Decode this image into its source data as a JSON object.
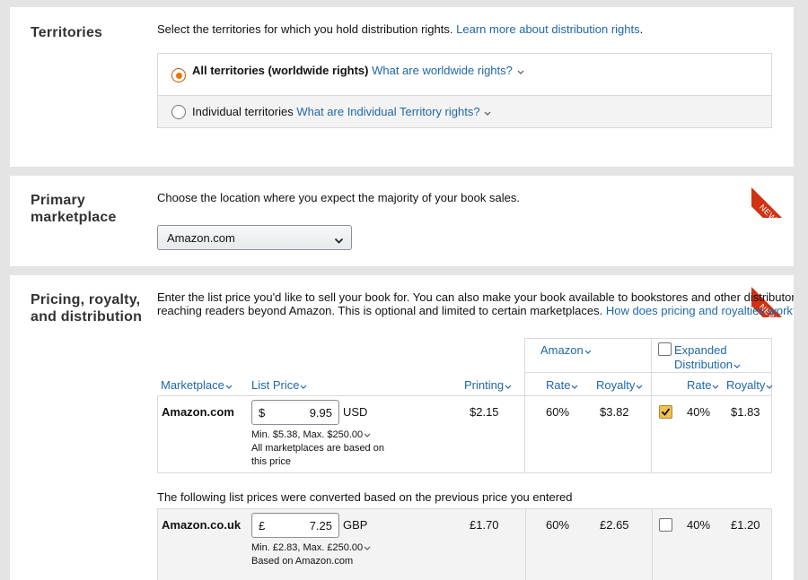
{
  "territories": {
    "title": "Territories",
    "intro": "Select the territories for which you hold distribution rights.",
    "learn_more_link": "Learn more about distribution rights",
    "option_all_label": "All territories (worldwide rights)",
    "option_all_link": "What are worldwide rights?",
    "option_individual_label": "Individual territories",
    "option_individual_link": "What are Individual Territory rights?",
    "selected": "all"
  },
  "marketplace": {
    "title_line1": "Primary",
    "title_line2": "marketplace",
    "intro": "Choose the location where you expect the majority of your book sales.",
    "selected": "Amazon.com",
    "badge": "NEW"
  },
  "pricing": {
    "title_line1": "Pricing, royalty,",
    "title_line2": "and distribution",
    "badge": "NEW",
    "intro_line1": "Enter the list price you'd like to sell your book for. You can also make your book available to bookstores and other distributors,",
    "intro_line2": "reaching readers beyond Amazon. This is optional and limited to certain marketplaces.",
    "intro_link": "How does pricing and royalties work?",
    "headers": {
      "amazon": "Amazon",
      "expanded_line1": "Expanded",
      "expanded_line2": "Distribution",
      "marketplace": "Marketplace",
      "list_price": "List Price",
      "printing": "Printing",
      "rate": "Rate",
      "royalty": "Royalty",
      "exp_rate": "Rate",
      "exp_royalty": "Royalty"
    },
    "expanded_all_checked": false,
    "rows": [
      {
        "marketplace": "Amazon.com",
        "currency_symbol": "$",
        "price": "9.95",
        "currency_code": "USD",
        "range": "Min. $5.38, Max. $250.00",
        "note_line1": "All marketplaces are based on",
        "note_line2": "this price",
        "printing": "$2.15",
        "rate": "60%",
        "royalty": "$3.82",
        "expanded_checked": true,
        "exp_rate": "40%",
        "exp_royalty": "$1.83"
      },
      {
        "marketplace": "Amazon.co.uk",
        "currency_symbol": "£",
        "price": "7.25",
        "currency_code": "GBP",
        "range": "Min. £2.83, Max. £250.00",
        "note_line1": "Based on Amazon.com",
        "printing": "£1.70",
        "rate": "60%",
        "royalty": "£2.65",
        "expanded_checked": false,
        "exp_rate": "40%",
        "exp_royalty": "£1.20"
      }
    ],
    "converted_note": "The following list prices were converted based on the previous price you entered"
  },
  "colors": {
    "link": "#1f67a8",
    "radio_accent": "#e77600",
    "badge": "#d13212",
    "checkbox_checked": "#f0c14b"
  }
}
